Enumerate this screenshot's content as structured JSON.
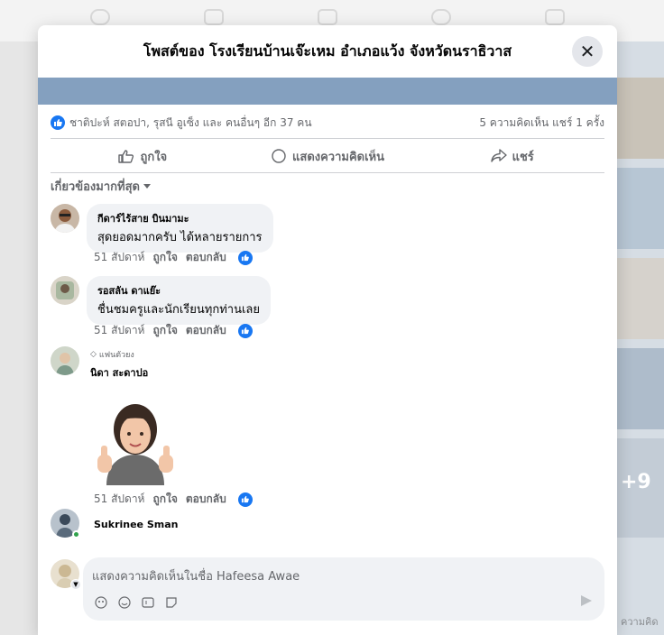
{
  "modal": {
    "title": "โพสต์ของ โรงเรียนบ้านเจ๊ะเหม อำเภอแว้ง จังหวัดนราธิวาส",
    "close_icon": "close-icon"
  },
  "reactions": {
    "names": "ชาติปะห์ สตอปา, รุสนี อูเซ็ง และ คนอื่นๆ อีก 37 คน",
    "counts": "5 ความคิดเห็น  แชร์ 1 ครั้ง"
  },
  "actions": {
    "like": "ถูกใจ",
    "comment": "แสดงความคิดเห็น",
    "share": "แชร์"
  },
  "sort_label": "เกี่ยวข้องมากที่สุด",
  "comments": [
    {
      "name": "กีดาร์ไร้สาย บินมามะ",
      "text": "สุดยอดมากครับ ได้หลายรายการ",
      "time": "51 สัปดาห์",
      "like": "ถูกใจ",
      "reply": "ตอบกลับ"
    },
    {
      "name": "รอสลัน ดาแย๊ะ",
      "text": "ชื่นชมครูและนักเรียนทุกท่านเลย",
      "time": "51 สัปดาห์",
      "like": "ถูกใจ",
      "reply": "ตอบกลับ"
    },
    {
      "badge": "แฟนตัวยง",
      "name": "นิดา สะดาปอ",
      "time": "51 สัปดาห์",
      "like": "ถูกใจ",
      "reply": "ตอบกลับ"
    },
    {
      "name": "Sukrinee Sman"
    }
  ],
  "composer": {
    "placeholder": "แสดงความคิดเห็นในชื่อ Hafeesa Awae"
  },
  "background": {
    "right_plus": "+9",
    "right_cut": "ความคิด"
  },
  "colors": {
    "accent": "#1877f2",
    "post_strip": "#84a0bf",
    "bubble": "#f0f2f5"
  }
}
